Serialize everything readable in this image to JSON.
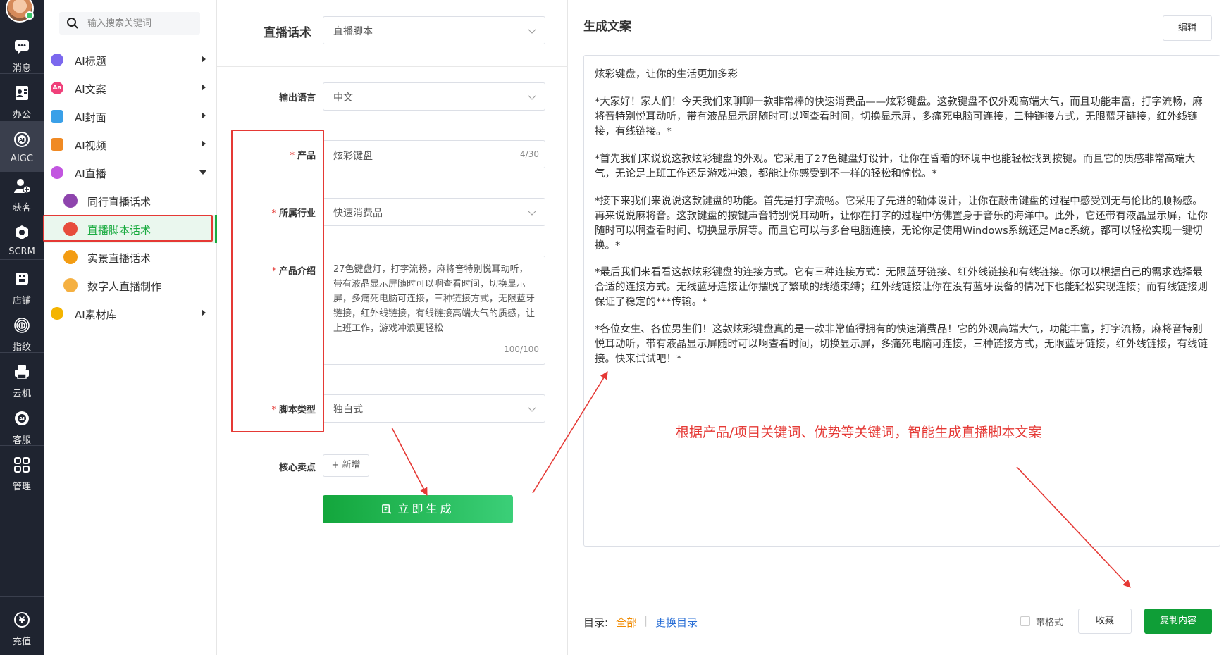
{
  "rail": {
    "items": [
      {
        "label": "消息",
        "icon": "message-icon"
      },
      {
        "label": "办公",
        "icon": "contacts-icon"
      },
      {
        "label": "AIGC",
        "icon": "aigc-icon"
      },
      {
        "label": "获客",
        "icon": "user-add-icon"
      },
      {
        "label": "SCRM",
        "icon": "scrm-icon"
      },
      {
        "label": "店铺",
        "icon": "store-icon"
      },
      {
        "label": "指纹",
        "icon": "fingerprint-icon"
      },
      {
        "label": "云机",
        "icon": "cloud-phone-icon"
      },
      {
        "label": "客服",
        "icon": "support-icon"
      },
      {
        "label": "管理",
        "icon": "grid-icon"
      }
    ],
    "recharge_label": "充值"
  },
  "menu": {
    "search_placeholder": "输入搜索关键词",
    "items": [
      {
        "label": "AI标题",
        "color": "#7b68ee"
      },
      {
        "label": "AI文案",
        "color": "#f0407a"
      },
      {
        "label": "AI封面",
        "color": "#3aa0e8"
      },
      {
        "label": "AI视频",
        "color": "#f08a24"
      },
      {
        "label": "AI直播",
        "color": "#c256e0"
      }
    ],
    "sub_items": [
      {
        "label": "同行直播话术",
        "color": "#8e44ad"
      },
      {
        "label": "直播脚本话术",
        "color": "#e74c3c"
      },
      {
        "label": "实景直播话术",
        "color": "#f39c12"
      },
      {
        "label": "数字人直播制作",
        "color": "#f5b041"
      }
    ],
    "library": {
      "label": "AI素材库",
      "color": "#f4b400"
    }
  },
  "form": {
    "header_label": "直播话术",
    "mode_value": "直播脚本",
    "language_label": "输出语言",
    "language_value": "中文",
    "product_label": "产品",
    "product_value": "炫彩键盘",
    "product_count": "4/30",
    "industry_label": "所属行业",
    "industry_value": "快速消费品",
    "intro_label": "产品介绍",
    "intro_value": "27色键盘灯，打字流畅，麻将音特别悦耳动听，带有液晶显示屏随时可以啊查看时间，切换显示屏，多痛死电脑可连接，三种链接方式，无限蓝牙链接，红外线链接，有线链接高端大气的质感，让上班工作，游戏冲浪更轻松",
    "intro_count": "100/100",
    "script_type_label": "脚本类型",
    "script_type_value": "独白式",
    "selling_label": "核心卖点",
    "add_label": "+ 新增",
    "generate_label": "立即生成"
  },
  "result": {
    "title": "生成文案",
    "edit_label": "编辑",
    "paragraphs": [
      "炫彩键盘，让你的生活更加多彩",
      "*大家好！家人们！今天我们来聊聊一款非常棒的快速消费品——炫彩键盘。这款键盘不仅外观高端大气，而且功能丰富，打字流畅，麻将音特别悦耳动听，带有液晶显示屏随时可以啊查看时间，切换显示屏，多痛死电脑可连接，三种链接方式，无限蓝牙链接，红外线链接，有线链接。*",
      "*首先我们来说说这款炫彩键盘的外观。它采用了27色键盘灯设计，让你在昏暗的环境中也能轻松找到按键。而且它的质感非常高端大气，无论是上班工作还是游戏冲浪，都能让你感受到不一样的轻松和愉悦。*",
      "*接下来我们来说说这款键盘的功能。首先是打字流畅。它采用了先进的轴体设计，让你在敲击键盘的过程中感受到无与伦比的顺畅感。再来说说麻将音。这款键盘的按键声音特别悦耳动听，让你在打字的过程中仿佛置身于音乐的海洋中。此外，它还带有液晶显示屏，让你随时可以啊查看时间、切换显示屏等。而且它可以与多台电脑连接，无论你是使用Windows系统还是Mac系统，都可以轻松实现一键切换。*",
      "*最后我们来看看这款炫彩键盘的连接方式。它有三种连接方式：无限蓝牙链接、红外线链接和有线链接。你可以根据自己的需求选择最合适的连接方式。无线蓝牙连接让你摆脱了繁琐的线缆束缚；红外线链接让你在没有蓝牙设备的情况下也能轻松实现连接；而有线链接则保证了稳定的***传输。*",
      "*各位女生、各位男生们！这款炫彩键盘真的是一款非常值得拥有的快速消费品！它的外观高端大气，功能丰富，打字流畅，麻将音特别悦耳动听，带有液晶显示屏随时可以啊查看时间，切换显示屏，多痛死电脑可连接，三种链接方式，无限蓝牙链接，红外线链接，有线链接。快来试试吧！*"
    ],
    "annotation": "根据产品/项目关键词、优势等关键词，智能生成直播脚本文案",
    "dir_label": "目录:",
    "dir_all": "全部",
    "dir_sep": "|",
    "dir_change": "更换目录",
    "format_label": "带格式",
    "favorite_label": "收藏",
    "copy_label": "复制内容"
  },
  "colors": {
    "accent_green": "#1aab40",
    "annotation_red": "#e53935",
    "link_orange": "#f08a00",
    "link_blue": "#2a6fd6"
  }
}
